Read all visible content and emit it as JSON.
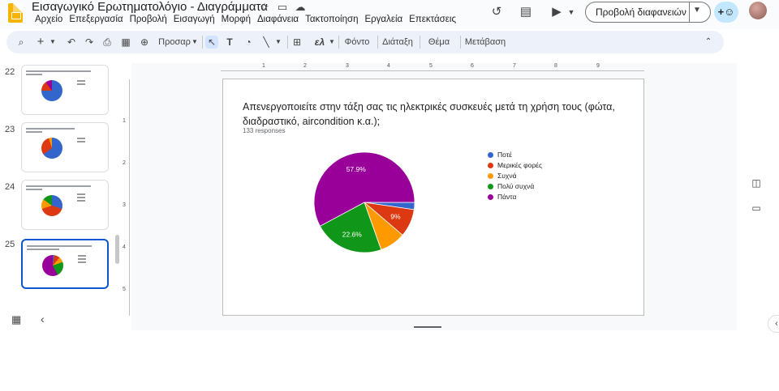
{
  "document": {
    "title": "Εισαγωγικό Ερωτηματολόγιο - Διαγράμματα"
  },
  "menu": [
    "Αρχείο",
    "Επεξεργασία",
    "Προβολή",
    "Εισαγωγή",
    "Μορφή",
    "Διαφάνεια",
    "Τακτοποίηση",
    "Εργαλεία",
    "Επεκτάσεις"
  ],
  "header": {
    "present_label": "Προβολή διαφανειών"
  },
  "toolbar": {
    "zoom_label": "Προσαρ",
    "background_label": "Φόντο",
    "layout_label": "Διάταξη",
    "theme_label": "Θέμα",
    "transition_label": "Μετάβαση"
  },
  "rulers": {
    "horizontal": [
      "1",
      "2",
      "3",
      "4",
      "5",
      "6",
      "7",
      "8",
      "9"
    ],
    "vertical": [
      "1",
      "2",
      "3",
      "4",
      "5"
    ]
  },
  "slides": [
    {
      "number": "22"
    },
    {
      "number": "23"
    },
    {
      "number": "24"
    },
    {
      "number": "25",
      "selected": true
    }
  ],
  "slide": {
    "question": "Απενεργοποιείτε στην τάξη σας τις ηλεκτρικές συσκευές μετά τη χρήση τους (φώτα, διαδραστικό, aircondition κ.α.);",
    "responses": "133 responses"
  },
  "chart_data": {
    "type": "pie",
    "categories": [
      "Ποτέ",
      "Μερικές φορές",
      "Συχνά",
      "Πολύ συχνά",
      "Πάντα"
    ],
    "values": [
      2.3,
      9.0,
      8.3,
      22.6,
      57.9
    ],
    "colors": [
      "#3366cc",
      "#dc3912",
      "#ff9900",
      "#109618",
      "#990099"
    ],
    "data_labels": [
      "",
      "9%",
      "",
      "22.6%",
      "57.9%"
    ],
    "legend": "right"
  }
}
